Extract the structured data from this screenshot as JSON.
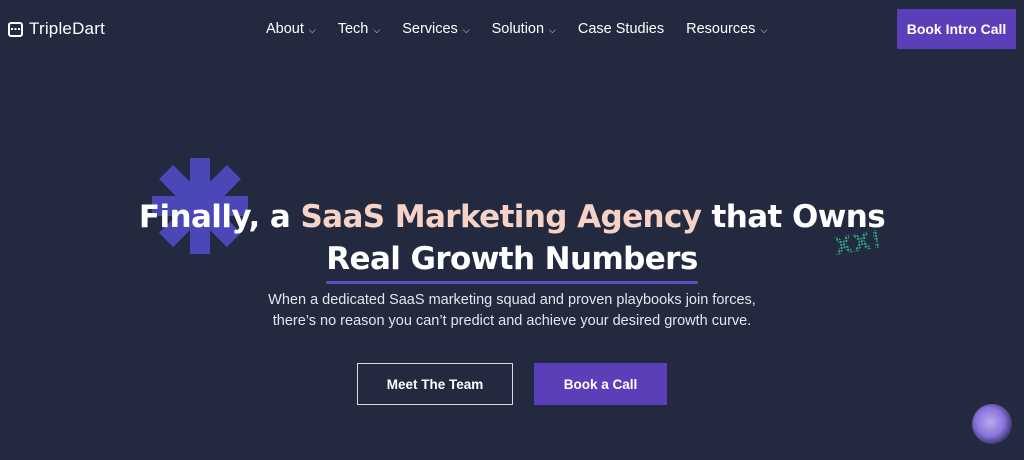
{
  "header": {
    "logo_text": "TripleDart",
    "nav": [
      {
        "label": "About",
        "has_dropdown": true
      },
      {
        "label": "Tech",
        "has_dropdown": true
      },
      {
        "label": "Services",
        "has_dropdown": true
      },
      {
        "label": "Solution",
        "has_dropdown": true
      },
      {
        "label": "Case Studies",
        "has_dropdown": false
      },
      {
        "label": "Resources",
        "has_dropdown": true
      }
    ],
    "cta_label": "Book Intro Call"
  },
  "hero": {
    "headline_part1": "Finally, a ",
    "headline_accent": "SaaS Marketing Agency",
    "headline_part2": " that Owns",
    "headline_line2": "Real Growth Numbers",
    "subtext_line1": "When a dedicated SaaS marketing squad and proven playbooks join forces,",
    "subtext_line2": "there’s no reason you can’t predict and achieve your desired growth curve.",
    "primary_button": "Meet The Team",
    "secondary_button": "Book a Call",
    "doodle_text": "XX!"
  },
  "colors": {
    "background": "#232a3f",
    "brand_purple": "#5b3fb8",
    "accent_peach": "#f6d3c6",
    "asterisk_blue": "#4a47b8",
    "doodle_green": "#2fb58a"
  },
  "icons": {
    "logo": "tripledart-logo-icon",
    "dropdown": "chevron-down-icon",
    "decoration": "asterisk-icon",
    "chat": "chat-widget-icon"
  }
}
